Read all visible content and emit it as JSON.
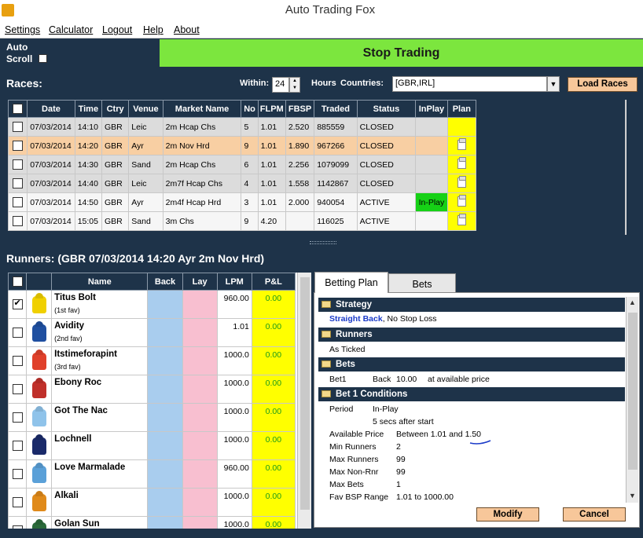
{
  "app": {
    "title": "Auto Trading Fox"
  },
  "menu": [
    {
      "label": "Settings"
    },
    {
      "label": "Calculator"
    },
    {
      "label": "Logout"
    },
    {
      "label": "Help"
    },
    {
      "label": "About"
    }
  ],
  "top": {
    "auto_scroll_line1": "Auto",
    "auto_scroll_line2": "Scroll",
    "stop_trading": "Stop Trading",
    "accent": "#7ce63e"
  },
  "races": {
    "title": "Races:",
    "within_label": "Within:",
    "within_value": "24",
    "hours_label": "Hours",
    "countries_label": "Countries:",
    "countries_value": "[GBR,IRL]",
    "load_races": "Load Races",
    "columns": [
      "Date",
      "Time",
      "Ctry",
      "Venue",
      "Market Name",
      "No",
      "FLPM",
      "FBSP",
      "Traded",
      "Status",
      "InPlay",
      "Plan"
    ],
    "rows": [
      {
        "date": "07/03/2014",
        "time": "14:10",
        "ctry": "GBR",
        "venue": "Leic",
        "market": "2m Hcap Chs",
        "no": "5",
        "flpm": "1.01",
        "fbsp": "2.520",
        "traded": "885559",
        "status": "CLOSED",
        "inplay": ""
      },
      {
        "date": "07/03/2014",
        "time": "14:20",
        "ctry": "GBR",
        "venue": "Ayr",
        "market": "2m Nov Hrd",
        "no": "9",
        "flpm": "1.01",
        "fbsp": "1.890",
        "traded": "967266",
        "status": "CLOSED",
        "inplay": ""
      },
      {
        "date": "07/03/2014",
        "time": "14:30",
        "ctry": "GBR",
        "venue": "Sand",
        "market": "2m Hcap Chs",
        "no": "6",
        "flpm": "1.01",
        "fbsp": "2.256",
        "traded": "1079099",
        "status": "CLOSED",
        "inplay": ""
      },
      {
        "date": "07/03/2014",
        "time": "14:40",
        "ctry": "GBR",
        "venue": "Leic",
        "market": "2m7f Hcap Chs",
        "no": "4",
        "flpm": "1.01",
        "fbsp": "1.558",
        "traded": "1142867",
        "status": "CLOSED",
        "inplay": ""
      },
      {
        "date": "07/03/2014",
        "time": "14:50",
        "ctry": "GBR",
        "venue": "Ayr",
        "market": "2m4f Hcap Hrd",
        "no": "3",
        "flpm": "1.01",
        "fbsp": "2.000",
        "traded": "940054",
        "status": "ACTIVE",
        "inplay": "In-Play"
      },
      {
        "date": "07/03/2014",
        "time": "15:05",
        "ctry": "GBR",
        "venue": "Sand",
        "market": "3m Chs",
        "no": "9",
        "flpm": "4.20",
        "fbsp": "",
        "traded": "116025",
        "status": "ACTIVE",
        "inplay": ""
      }
    ]
  },
  "runners": {
    "title": "Runners:  (GBR 07/03/2014 14:20 Ayr  2m Nov Hrd)",
    "columns": [
      "Name",
      "Back",
      "Lay",
      "LPM",
      "P&L"
    ],
    "rows": [
      {
        "name": "Titus Bolt",
        "fav": "(1st fav)",
        "lpm": "960.00",
        "pl": "0.00",
        "checked": true,
        "silk": "#f0d000"
      },
      {
        "name": "Avidity",
        "fav": "(2nd fav)",
        "lpm": "1.01",
        "pl": "0.00",
        "checked": false,
        "silk": "#1f4fa0"
      },
      {
        "name": "Itstimeforapint",
        "fav": "(3rd fav)",
        "lpm": "1000.0",
        "pl": "0.00",
        "checked": false,
        "silk": "#e0402a"
      },
      {
        "name": "Ebony Roc",
        "fav": "",
        "lpm": "1000.0",
        "pl": "0.00",
        "checked": false,
        "silk": "#c0302a"
      },
      {
        "name": "Got The Nac",
        "fav": "",
        "lpm": "1000.0",
        "pl": "0.00",
        "checked": false,
        "silk": "#8fc3ea"
      },
      {
        "name": "Lochnell",
        "fav": "",
        "lpm": "1000.0",
        "pl": "0.00",
        "checked": false,
        "silk": "#1a2a6a"
      },
      {
        "name": "Love Marmalade",
        "fav": "",
        "lpm": "960.00",
        "pl": "0.00",
        "checked": false,
        "silk": "#5aa0d8"
      },
      {
        "name": "Alkali",
        "fav": "",
        "lpm": "1000.0",
        "pl": "0.00",
        "checked": false,
        "silk": "#e08a1a"
      },
      {
        "name": "Golan Sun",
        "fav": "",
        "lpm": "1000.0",
        "pl": "0.00",
        "checked": false,
        "silk": "#2a6a3a"
      }
    ]
  },
  "plan": {
    "tab_plan": "Betting Plan",
    "tab_bets": "Bets",
    "strategy_hdr": "Strategy",
    "strategy_link": "Straight Back",
    "strategy_rest": ", No Stop Loss",
    "runners_hdr": "Runners",
    "runners_text": "As Ticked",
    "bets_hdr": "Bets",
    "bet1_name": "Bet1",
    "bet1_type": "Back",
    "bet1_amount": "10.00",
    "bet1_price": "at available price",
    "cond_hdr": "Bet 1 Conditions",
    "conditions": [
      {
        "k": "Period",
        "v": "In-Play"
      },
      {
        "k": "",
        "v": "5 secs after start"
      },
      {
        "k": "Available Price",
        "v": "Between 1.01 and 1.50"
      },
      {
        "k": "Min Runners",
        "v": "2"
      },
      {
        "k": "Max Runners",
        "v": "99"
      },
      {
        "k": "Max Non-Rnr",
        "v": "99"
      },
      {
        "k": "Max Bets",
        "v": "1"
      },
      {
        "k": "Fav BSP Range",
        "v": "1.01 to 1000.00"
      }
    ],
    "modify": "Modify",
    "cancel": "Cancel"
  }
}
